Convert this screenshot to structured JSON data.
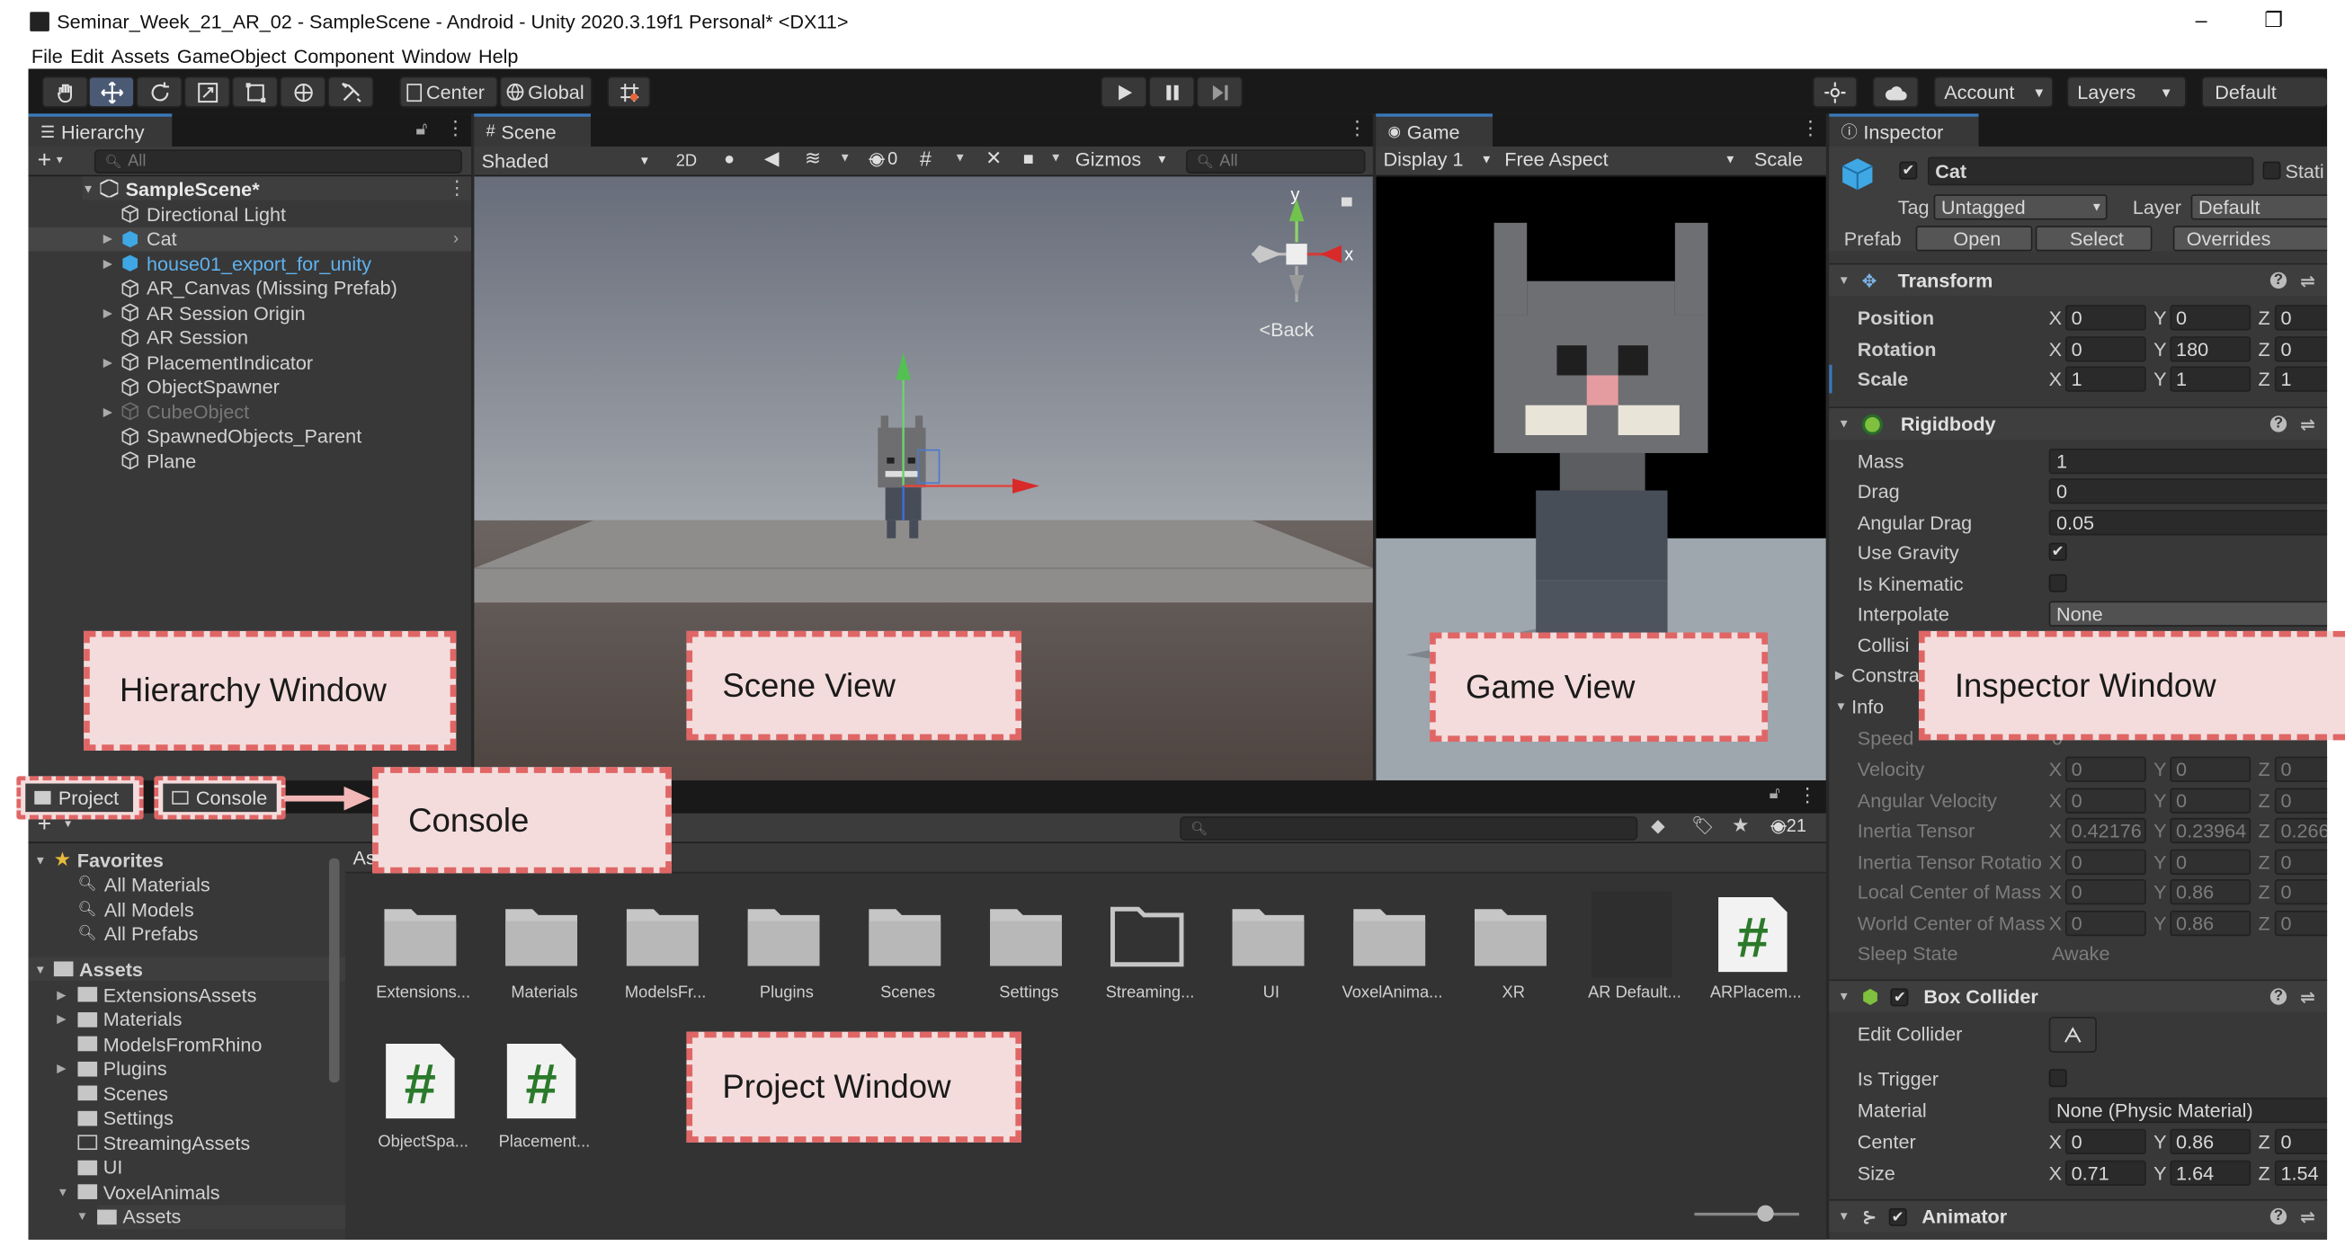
{
  "window": {
    "title": "Seminar_Week_21_AR_02 - SampleScene - Android - Unity 2020.3.19f1 Personal* <DX11>",
    "minimize": "–",
    "restore": "❐"
  },
  "menu": [
    "File",
    "Edit",
    "Assets",
    "GameObject",
    "Component",
    "Window",
    "Help"
  ],
  "toolbar": {
    "pivot": "Center",
    "space": "Global",
    "account": "Account",
    "layers": "Layers",
    "layout": "Default"
  },
  "hierarchy": {
    "tab": "Hierarchy",
    "add": "+",
    "search_placeholder": "All",
    "scene": "SampleScene*",
    "items": [
      {
        "label": "Directional Light",
        "kind": "normal",
        "arrow": ""
      },
      {
        "label": "Cat",
        "kind": "prefab-selected",
        "arrow": "▶"
      },
      {
        "label": "house01_export_for_unity",
        "kind": "prefab",
        "arrow": "▶"
      },
      {
        "label": "AR_Canvas (Missing Prefab)",
        "kind": "normal",
        "arrow": ""
      },
      {
        "label": "AR Session Origin",
        "kind": "normal",
        "arrow": "▶"
      },
      {
        "label": "AR Session",
        "kind": "normal",
        "arrow": ""
      },
      {
        "label": "PlacementIndicator",
        "kind": "normal",
        "arrow": "▶"
      },
      {
        "label": "ObjectSpawner",
        "kind": "normal",
        "arrow": ""
      },
      {
        "label": "CubeObject",
        "kind": "disabled",
        "arrow": "▶"
      },
      {
        "label": "SpawnedObjects_Parent",
        "kind": "normal",
        "arrow": ""
      },
      {
        "label": "Plane",
        "kind": "normal",
        "arrow": ""
      }
    ]
  },
  "scene": {
    "tab": "Scene",
    "shading": "Shaded",
    "mode2d": "2D",
    "hidden_count": "0",
    "gizmos": "Gizmos",
    "search_placeholder": "All",
    "back": "<Back",
    "axis_x": "x",
    "axis_y": "y"
  },
  "game": {
    "tab": "Game",
    "display": "Display 1",
    "aspect": "Free Aspect",
    "scale": "Scale"
  },
  "inspector": {
    "tab": "Inspector",
    "name": "Cat",
    "static": "Stati",
    "tag_label": "Tag",
    "tag": "Untagged",
    "layer_label": "Layer",
    "layer": "Default",
    "prefab_label": "Prefab",
    "open": "Open",
    "select": "Select",
    "overrides": "Overrides",
    "transform": {
      "title": "Transform",
      "rows": [
        {
          "label": "Position",
          "x": "0",
          "y": "0",
          "z": "0"
        },
        {
          "label": "Rotation",
          "x": "0",
          "y": "180",
          "z": "0"
        },
        {
          "label": "Scale",
          "x": "1",
          "y": "1",
          "z": "1"
        }
      ]
    },
    "rigidbody": {
      "title": "Rigidbody",
      "mass_label": "Mass",
      "mass": "1",
      "drag_label": "Drag",
      "drag": "0",
      "angular_drag_label": "Angular Drag",
      "angular_drag": "0.05",
      "use_gravity_label": "Use Gravity",
      "use_gravity_check": "✔",
      "is_kinematic_label": "Is Kinematic",
      "interpolate_label": "Interpolate",
      "interpolate": "None",
      "collision_label": "Collisi",
      "constraints_label": "Constra",
      "info_label": "Info",
      "speed_label": "Speed",
      "speed": "0",
      "velocity_label": "Velocity",
      "velocity": {
        "x": "0",
        "y": "0",
        "z": "0"
      },
      "angular_velocity_label": "Angular Velocity",
      "angular_velocity": {
        "x": "0",
        "y": "0",
        "z": "0"
      },
      "inertia_tensor_label": "Inertia Tensor",
      "inertia_tensor": {
        "x": "0.42176",
        "y": "0.23964",
        "z": "0.266"
      },
      "inertia_rotation_label": "Inertia Tensor Rotatio",
      "inertia_rotation": {
        "x": "0",
        "y": "0",
        "z": "0"
      },
      "local_com_label": "Local Center of Mass",
      "local_com": {
        "x": "0",
        "y": "0.86",
        "z": "0"
      },
      "world_com_label": "World Center of Mass",
      "world_com": {
        "x": "0",
        "y": "0.86",
        "z": "0"
      },
      "sleep_label": "Sleep State",
      "sleep": "Awake"
    },
    "box_collider": {
      "title": "Box Collider",
      "edit_label": "Edit Collider",
      "trigger_label": "Is Trigger",
      "material_label": "Material",
      "material": "None (Physic Material)",
      "center_label": "Center",
      "center": {
        "x": "0",
        "y": "0.86",
        "z": "0"
      },
      "size_label": "Size",
      "size": {
        "x": "0.71",
        "y": "1.64",
        "z": "1.54"
      }
    },
    "animator": {
      "title": "Animator"
    }
  },
  "project": {
    "tab_project": "Project",
    "tab_console": "Console",
    "add": "+",
    "hidden_count": "21",
    "favorites": "Favorites",
    "fav_items": [
      "All Materials",
      "All Models",
      "All Prefabs"
    ],
    "assets": "Assets",
    "tree": [
      {
        "label": "ExtensionsAssets",
        "arrow": "▶"
      },
      {
        "label": "Materials",
        "arrow": "▶"
      },
      {
        "label": "ModelsFromRhino",
        "arrow": ""
      },
      {
        "label": "Plugins",
        "arrow": "▶"
      },
      {
        "label": "Scenes",
        "arrow": ""
      },
      {
        "label": "Settings",
        "arrow": ""
      },
      {
        "label": "StreamingAssets",
        "arrow": ""
      },
      {
        "label": "UI",
        "arrow": ""
      },
      {
        "label": "VoxelAnimals",
        "arrow": "▼"
      },
      {
        "label": "Assets",
        "arrow": "▼"
      }
    ],
    "breadcrumb": "As",
    "grid": [
      {
        "label": "Extensions...",
        "kind": "folder"
      },
      {
        "label": "Materials",
        "kind": "folder"
      },
      {
        "label": "ModelsFr...",
        "kind": "folder"
      },
      {
        "label": "Plugins",
        "kind": "folder"
      },
      {
        "label": "Scenes",
        "kind": "folder"
      },
      {
        "label": "Settings",
        "kind": "folder"
      },
      {
        "label": "Streaming...",
        "kind": "folder-open"
      },
      {
        "label": "UI",
        "kind": "folder"
      },
      {
        "label": "VoxelAnima...",
        "kind": "folder"
      },
      {
        "label": "XR",
        "kind": "folder"
      },
      {
        "label": "AR Default...",
        "kind": "dark"
      },
      {
        "label": "ARPlacem...",
        "kind": "script"
      },
      {
        "label": "ObjectSpa...",
        "kind": "script"
      },
      {
        "label": "Placement...",
        "kind": "script"
      }
    ],
    "script_glyph": "#"
  },
  "annotations": {
    "hierarchy": "Hierarchy Window",
    "scene": "Scene View",
    "game": "Game View",
    "inspector": "Inspector Window",
    "console": "Console",
    "project": "Project Window"
  }
}
